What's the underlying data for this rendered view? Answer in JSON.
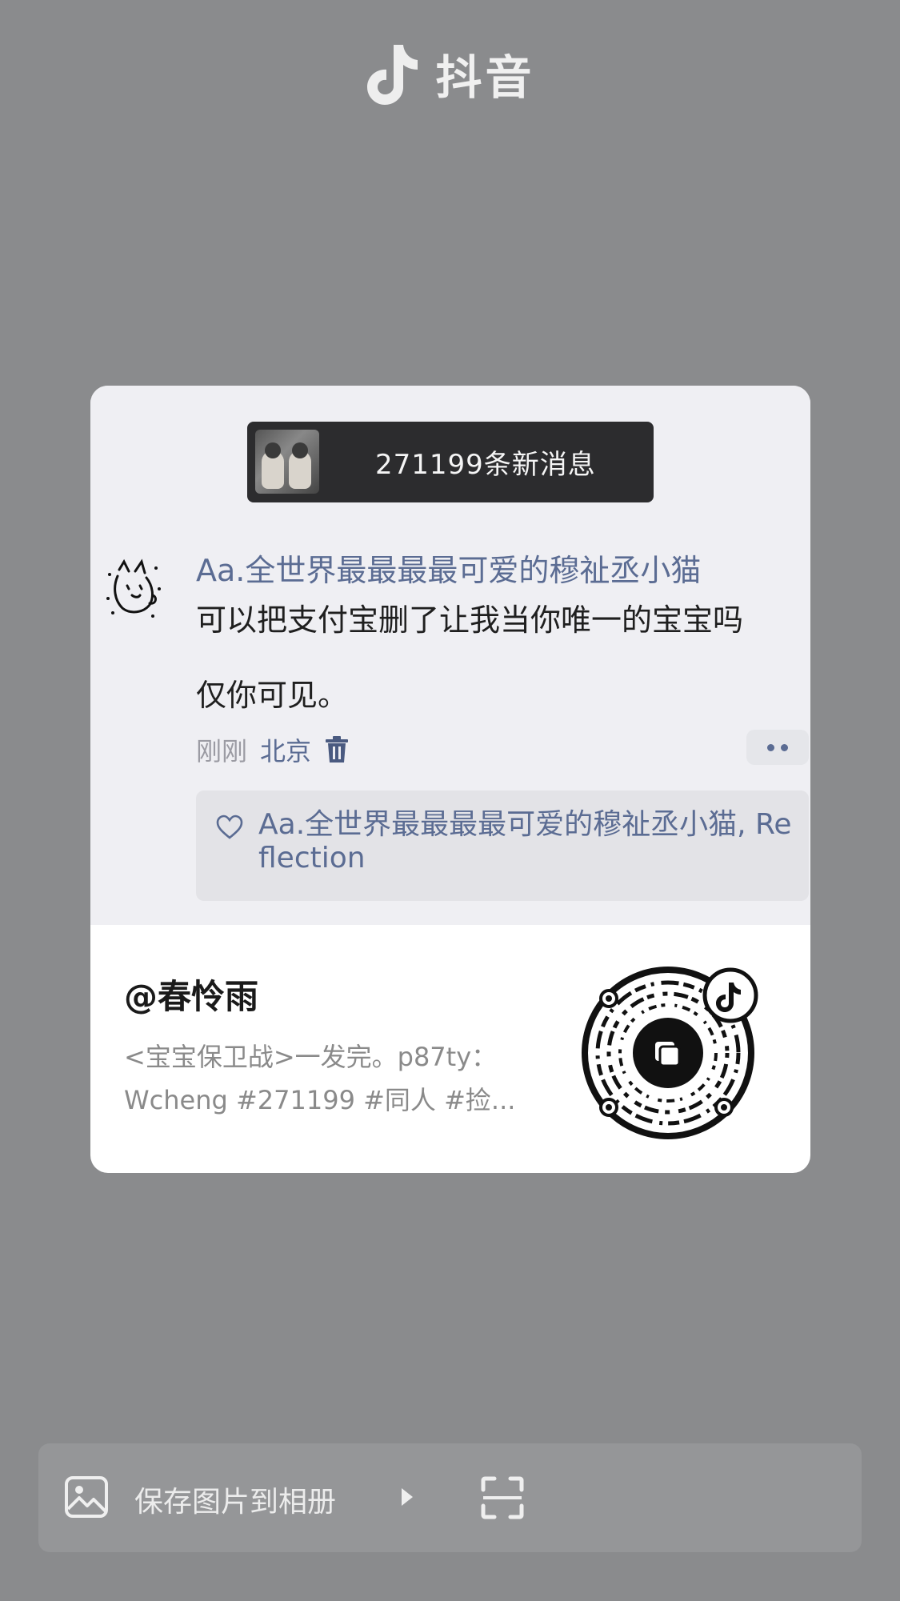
{
  "brand": {
    "name": "抖音"
  },
  "card": {
    "notification": "271199条新消息",
    "comment": {
      "username": "Aa.全世界最最最最可爱的穆祉丞小猫",
      "text": "可以把支付宝删了让我当你唯一的宝宝吗",
      "visibility": "仅你可见。",
      "time": "刚刚",
      "location": "北京"
    },
    "likes_text": "Aa.全世界最最最最可爱的穆祉丞小猫, Reflection"
  },
  "share": {
    "handle": "@春怜雨",
    "description": "<宝宝保卫战>一发完。p87ty：Wcheng #271199 #同人 #捡..."
  },
  "actions": {
    "save_label": "保存图片到相册"
  }
}
